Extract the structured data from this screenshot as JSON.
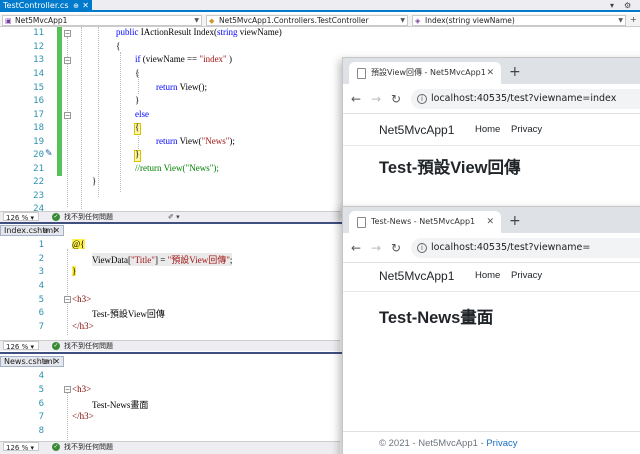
{
  "vs": {
    "tab": {
      "label": "TestController.cs",
      "pin": "⊕",
      "close": "✕"
    },
    "nav": {
      "project": "Net5MvcApp1",
      "class": "Net5MvcApp1.Controllers.TestController",
      "member": "Index(string viewName)"
    }
  },
  "controller_pane": {
    "line_numbers": [
      "11",
      "12",
      "13",
      "14",
      "15",
      "16",
      "17",
      "18",
      "19",
      "20",
      "21",
      "22",
      "23",
      "24"
    ],
    "lines": {
      "l11a": "public ",
      "l11b": "IActionResult",
      "l11c": " Index(",
      "l11d": "string",
      "l11e": " viewName)",
      "l12": "{",
      "l13a": "if ",
      "l13b": "(viewName == ",
      "l13c": "\"index\"",
      "l13d": " )",
      "l14": "{",
      "l15a": "return ",
      "l15b": "View();",
      "l16": "}",
      "l17": "else",
      "l18": "{",
      "l19a": "return ",
      "l19b": "View(",
      "l19c": "\"News\"",
      "l19d": ");",
      "l20": "}",
      "l21": "//return View(\"News\");",
      "l22": "}"
    },
    "status": {
      "zoom": "126 %",
      "message": "找不到任何問題"
    }
  },
  "index_pane": {
    "title": "Index.cshtml",
    "line_numbers": [
      "1",
      "2",
      "3",
      "4",
      "5",
      "6",
      "7"
    ],
    "lines": {
      "l1": "@{",
      "l2a": "ViewData[",
      "l2b": "\"Title\"",
      "l2c": "] = ",
      "l2d": "\"預設View回傳\"",
      "l2e": ";",
      "l3": "}",
      "l5": "<h3>",
      "l6": "Test-預設View回傳",
      "l7": "</h3>"
    },
    "status": {
      "zoom": "126 %",
      "message": "找不到任何問題"
    }
  },
  "news_pane": {
    "title": "News.cshtml",
    "line_numbers": [
      "4",
      "5",
      "6",
      "7",
      "8"
    ],
    "lines": {
      "l5": "<h3>",
      "l6": "Test-News畫面",
      "l7": "</h3>"
    },
    "status": {
      "zoom": "126 %",
      "message": "找不到任何問題"
    }
  },
  "browser_top": {
    "tab_title": "預設View回傳 - Net5MvcApp1",
    "url": "localhost:40535/test?viewname=index",
    "brand": "Net5MvcApp1",
    "nav_home": "Home",
    "nav_privacy": "Privacy",
    "heading": "Test-預設View回傳"
  },
  "browser_bottom": {
    "tab_title": "Test-News - Net5MvcApp1",
    "url": "localhost:40535/test?viewname=",
    "brand": "Net5MvcApp1",
    "nav_home": "Home",
    "nav_privacy": "Privacy",
    "heading": "Test-News畫面",
    "footer_text": "© 2021 - Net5MvcApp1 - ",
    "footer_link": "Privacy"
  },
  "colors": {
    "vs_accent": "#007acc",
    "keyword": "#0000ff",
    "string": "#a31515",
    "comment": "#008000",
    "change_bar": "#57c257"
  }
}
